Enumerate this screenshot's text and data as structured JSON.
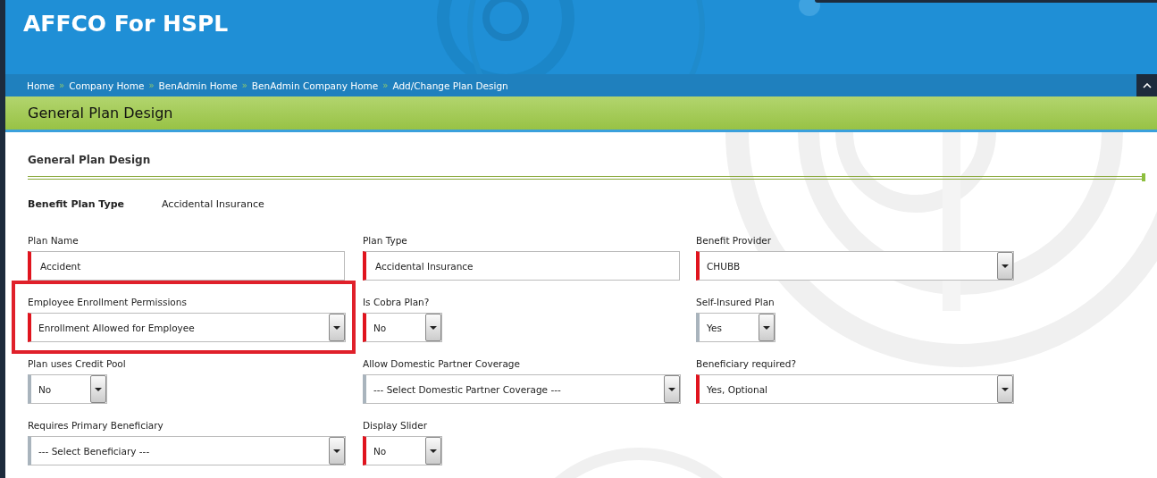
{
  "header": {
    "title": "AFFCO For HSPL"
  },
  "breadcrumb": [
    "Home",
    "Company Home",
    "BenAdmin Home",
    "BenAdmin Company Home",
    "Add/Change Plan Design"
  ],
  "breadcrumb_separator": "»",
  "page_title": "General Plan Design",
  "section_title": "General Plan Design",
  "plan_type_row": {
    "label": "Benefit Plan Type",
    "value": "Accidental Insurance"
  },
  "fields": [
    {
      "label": "Plan Name",
      "kind": "text",
      "value": "Accident",
      "required": true,
      "highlighted": false
    },
    {
      "label": "Plan Type",
      "kind": "text",
      "value": "Accidental Insurance",
      "required": true,
      "highlighted": false
    },
    {
      "label": "Benefit Provider",
      "kind": "select",
      "value": "CHUBB",
      "required": true,
      "highlighted": false
    },
    {
      "label": "Employee Enrollment Permissions",
      "kind": "select",
      "value": "Enrollment Allowed for Employee",
      "required": true,
      "highlighted": true
    },
    {
      "label": "Is Cobra Plan?",
      "kind": "short-select",
      "value": "No",
      "required": true,
      "highlighted": false
    },
    {
      "label": "Self-Insured Plan",
      "kind": "short-select",
      "value": "Yes",
      "required": false,
      "highlighted": false
    },
    {
      "label": "Plan uses Credit Pool",
      "kind": "short-select",
      "value": "No",
      "required": false,
      "highlighted": false
    },
    {
      "label": "Allow Domestic Partner Coverage",
      "kind": "select",
      "value": "--- Select Domestic Partner Coverage ---",
      "required": false,
      "highlighted": false
    },
    {
      "label": "Beneficiary required?",
      "kind": "select",
      "value": "Yes, Optional",
      "required": true,
      "highlighted": false
    },
    {
      "label": "Requires Primary Beneficiary",
      "kind": "select",
      "value": "--- Select Beneficiary ---",
      "required": false,
      "highlighted": false
    },
    {
      "label": "Display Slider",
      "kind": "short-select",
      "value": "No",
      "required": true,
      "highlighted": false
    }
  ]
}
